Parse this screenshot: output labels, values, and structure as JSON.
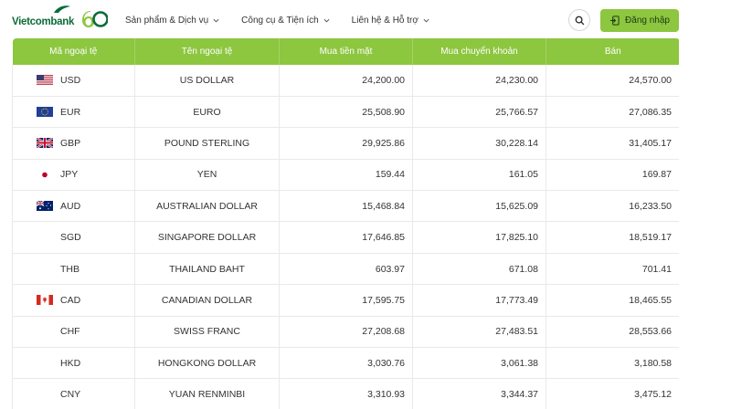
{
  "brand": {
    "name": "Vietcombank",
    "anniversary": "60",
    "accent": "#8dc63f",
    "brand_green": "#0b6b3a"
  },
  "nav": [
    {
      "label": "Sản phẩm & Dịch vụ"
    },
    {
      "label": "Công cụ & Tiện ích"
    },
    {
      "label": "Liên hệ & Hỗ trợ"
    }
  ],
  "header": {
    "search_icon": "search-icon",
    "login_label": "Đăng nhập",
    "login_icon": "login-icon"
  },
  "table": {
    "columns": [
      "Mã ngoại tệ",
      "Tên ngoại tệ",
      "Mua tiền mặt",
      "Mua chuyển khoản",
      "Bán"
    ],
    "rows": [
      {
        "code": "USD",
        "flag": "us",
        "name": "US DOLLAR",
        "cash": "24,200.00",
        "transfer": "24,230.00",
        "sell": "24,570.00"
      },
      {
        "code": "EUR",
        "flag": "eu",
        "name": "EURO",
        "cash": "25,508.90",
        "transfer": "25,766.57",
        "sell": "27,086.35"
      },
      {
        "code": "GBP",
        "flag": "gb",
        "name": "POUND STERLING",
        "cash": "29,925.86",
        "transfer": "30,228.14",
        "sell": "31,405.17"
      },
      {
        "code": "JPY",
        "flag": "jp",
        "name": "YEN",
        "cash": "159.44",
        "transfer": "161.05",
        "sell": "169.87"
      },
      {
        "code": "AUD",
        "flag": "au",
        "name": "AUSTRALIAN DOLLAR",
        "cash": "15,468.84",
        "transfer": "15,625.09",
        "sell": "16,233.50"
      },
      {
        "code": "SGD",
        "flag": "",
        "name": "SINGAPORE DOLLAR",
        "cash": "17,646.85",
        "transfer": "17,825.10",
        "sell": "18,519.17"
      },
      {
        "code": "THB",
        "flag": "",
        "name": "THAILAND BAHT",
        "cash": "603.97",
        "transfer": "671.08",
        "sell": "701.41"
      },
      {
        "code": "CAD",
        "flag": "ca",
        "name": "CANADIAN DOLLAR",
        "cash": "17,595.75",
        "transfer": "17,773.49",
        "sell": "18,465.55"
      },
      {
        "code": "CHF",
        "flag": "",
        "name": "SWISS FRANC",
        "cash": "27,208.68",
        "transfer": "27,483.51",
        "sell": "28,553.66"
      },
      {
        "code": "HKD",
        "flag": "",
        "name": "HONGKONG DOLLAR",
        "cash": "3,030.76",
        "transfer": "3,061.38",
        "sell": "3,180.58"
      },
      {
        "code": "CNY",
        "flag": "",
        "name": "YUAN RENMINBI",
        "cash": "3,310.93",
        "transfer": "3,344.37",
        "sell": "3,475.12"
      }
    ]
  }
}
